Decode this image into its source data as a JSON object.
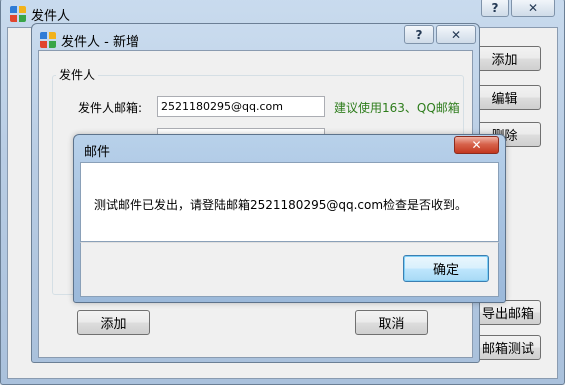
{
  "main_window": {
    "title": "发件人",
    "help_glyph": "?",
    "close_glyph": "✕",
    "buttons": {
      "add": "添加",
      "edit": "编辑",
      "delete": "删除",
      "export": "导出邮箱",
      "test": "邮箱测试"
    }
  },
  "dialog": {
    "title": "发件人 - 新增",
    "help_glyph": "?",
    "close_glyph": "✕",
    "group_title": "发件人",
    "email_label": "发件人邮箱:",
    "email_value": "2521180295@qq.com",
    "email_hint": "建议使用163、QQ邮箱",
    "add_button": "添加",
    "cancel_button": "取消"
  },
  "message_box": {
    "title": "邮件",
    "close_glyph": "✕",
    "message": "测试邮件已发出，请登陆邮箱2521180295@qq.com检查是否收到。",
    "ok_button": "确定"
  },
  "colors": {
    "hint_text": "#2e7d1c",
    "window_frame": "#b9cde4",
    "close_button": "#c3381f"
  }
}
